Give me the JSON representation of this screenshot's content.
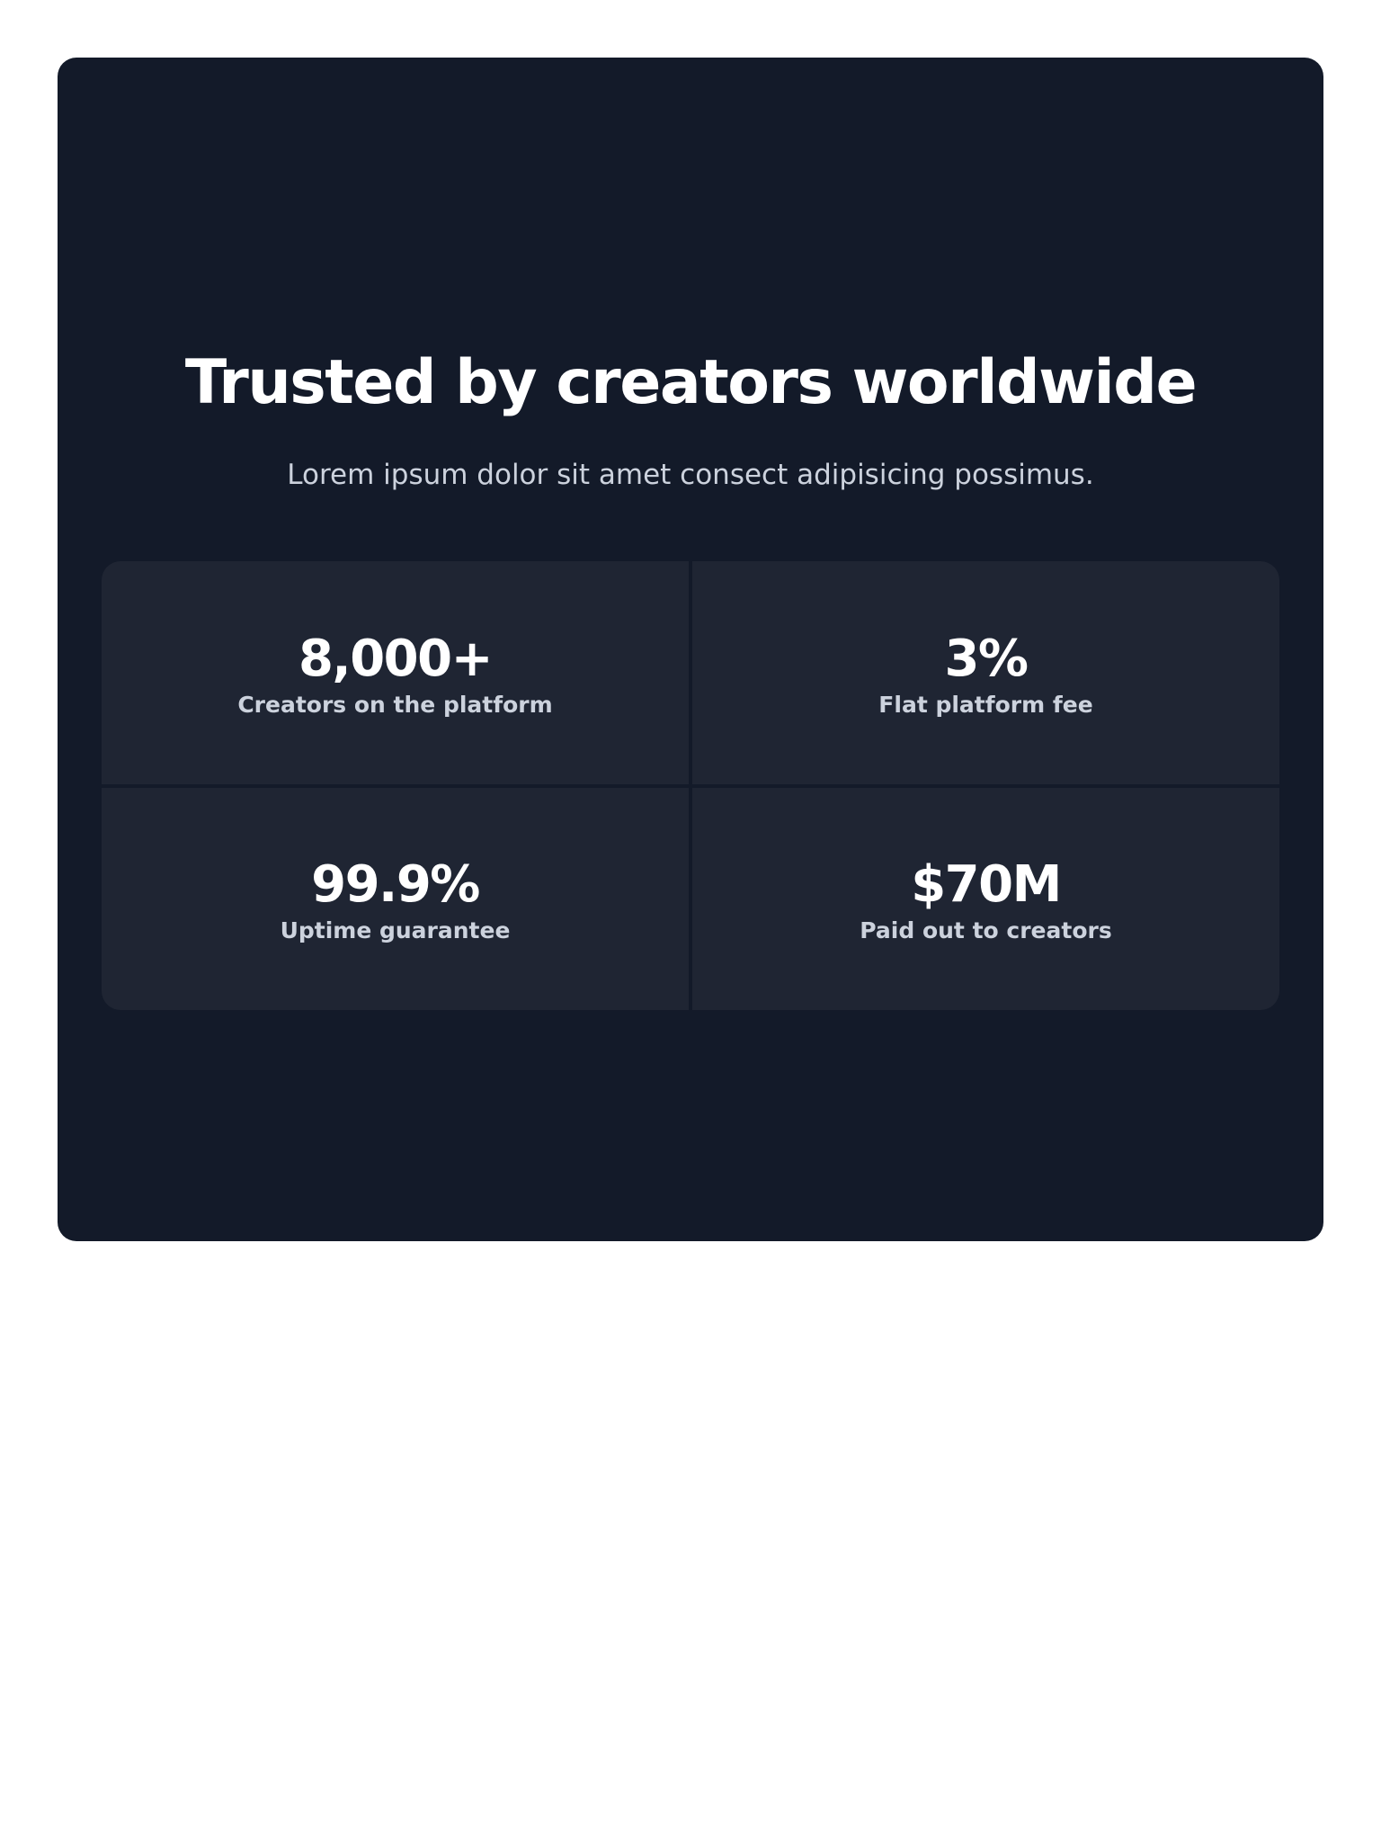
{
  "section": {
    "title": "Trusted by creators worldwide",
    "subtitle": "Lorem ipsum dolor sit amet consect adipisicing possimus."
  },
  "stats": [
    {
      "value": "8,000+",
      "label": "Creators on the platform"
    },
    {
      "value": "3%",
      "label": "Flat platform fee"
    },
    {
      "value": "99.9%",
      "label": "Uptime guarantee"
    },
    {
      "value": "$70M",
      "label": "Paid out to creators"
    }
  ],
  "colors": {
    "page_background": "#ffffff",
    "panel_background": "#131a29",
    "card_background": "#1f2533",
    "heading_text": "#ffffff",
    "muted_text": "#ccd2dd"
  }
}
